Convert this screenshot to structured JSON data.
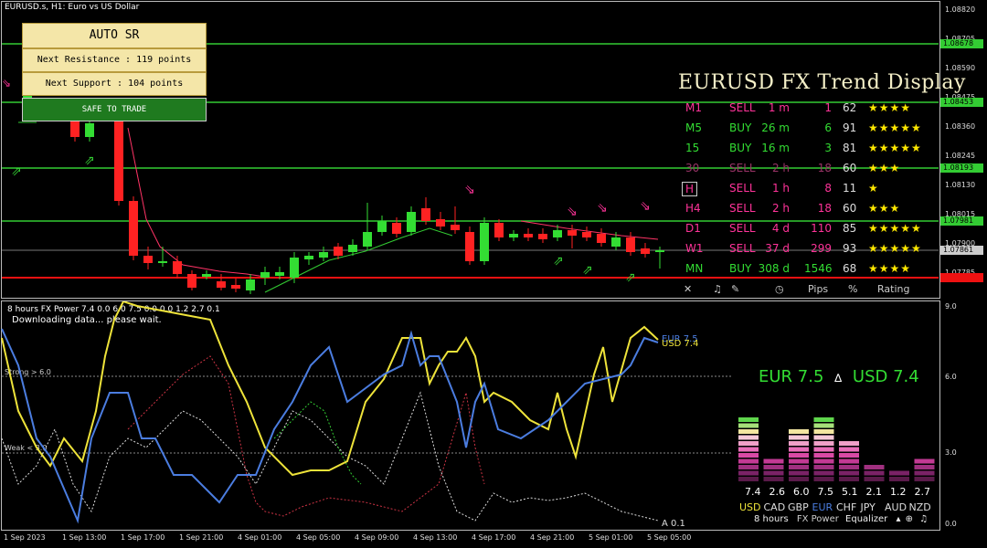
{
  "chart": {
    "title": "EURUSD.s, H1:  Euro vs US Dollar",
    "prices": [
      "1.08820",
      "1.08705",
      "1.08590",
      "1.08475",
      "1.08360",
      "1.08245",
      "1.08130",
      "1.08015",
      "1.07900",
      "1.07785"
    ],
    "line_labels": [
      "1.08678",
      "1.08453",
      "1.08193",
      "1.07981",
      "1.07861"
    ],
    "current_price": "1.07861"
  },
  "auto_sr": {
    "title": "AUTO SR",
    "resistance": "Next Resistance : 119 points",
    "support": "Next Support : 104 points",
    "status": "SAFE TO TRADE"
  },
  "trend": {
    "title": "EURUSD FX Trend Display",
    "rows": [
      {
        "tf": "M1",
        "dir": "SELL",
        "time": "1 m",
        "pips": "1",
        "pct": "62",
        "stars": "★★★★"
      },
      {
        "tf": "M5",
        "dir": "BUY",
        "time": "26 m",
        "pips": "6",
        "pct": "91",
        "stars": "★★★★★"
      },
      {
        "tf": "15",
        "dir": "BUY",
        "time": "16 m",
        "pips": "3",
        "pct": "81",
        "stars": "★★★★★"
      },
      {
        "tf": "30",
        "dir": "SELL",
        "time": "2 h",
        "pips": "18",
        "pct": "60",
        "stars": "★★★"
      },
      {
        "tf": "H",
        "dir": "SELL",
        "time": "1 h",
        "pips": "8",
        "pct": "11",
        "stars": "★"
      },
      {
        "tf": "H4",
        "dir": "SELL",
        "time": "2 h",
        "pips": "18",
        "pct": "60",
        "stars": "★★★"
      },
      {
        "tf": "D1",
        "dir": "SELL",
        "time": "4 d",
        "pips": "110",
        "pct": "85",
        "stars": "★★★★★"
      },
      {
        "tf": "W1",
        "dir": "SELL",
        "time": "37 d",
        "pips": "299",
        "pct": "93",
        "stars": "★★★★★"
      },
      {
        "tf": "MN",
        "dir": "BUY",
        "time": "308 d",
        "pips": "1546",
        "pct": "68",
        "stars": "★★★★"
      }
    ],
    "footer": {
      "close": "✕",
      "pips": "Pips",
      "pct": "%",
      "rating": "Rating"
    },
    "colors": {
      "buy": "#33dd33",
      "sell": "#ff3399",
      "faded_sell": "#993366"
    }
  },
  "indicator": {
    "header": "8 hours FX Power 7.4 0.0 6.0 7.5 0.0 0.0 1.2 2.7 0.1",
    "status": "Downloading data... please wait.",
    "strong_label": "Strong > 6.0",
    "weak_label": "Weak < 3.0",
    "y_labels": [
      "9.0",
      "6.0",
      "3.0",
      "0.0"
    ],
    "eur_label": "EUR 7.5",
    "usd_label": "USD 7.4",
    "cross_a": "A 0.1",
    "pair_eur": "EUR 7.5",
    "pair_sep": "∆",
    "pair_usd": "USD 7.4",
    "eq_values": [
      "7.4",
      "2.6",
      "6.0",
      "7.5",
      "5.1",
      "2.1",
      "1.2",
      "2.7"
    ],
    "eq_currencies": [
      "USD",
      "CAD",
      "GBP",
      "EUR",
      "CHF",
      "JPY",
      "AUD",
      "NZD"
    ],
    "footer": {
      "hours": "8 hours",
      "fxpower": "FX Power",
      "equalizer": "Equalizer"
    }
  },
  "x_axis": [
    "1 Sep 2023",
    "1 Sep 13:00",
    "1 Sep 17:00",
    "1 Sep 21:00",
    "4 Sep 01:00",
    "4 Sep 05:00",
    "4 Sep 09:00",
    "4 Sep 13:00",
    "4 Sep 17:00",
    "4 Sep 21:00",
    "5 Sep 01:00",
    "5 Sep 05:00"
  ]
}
